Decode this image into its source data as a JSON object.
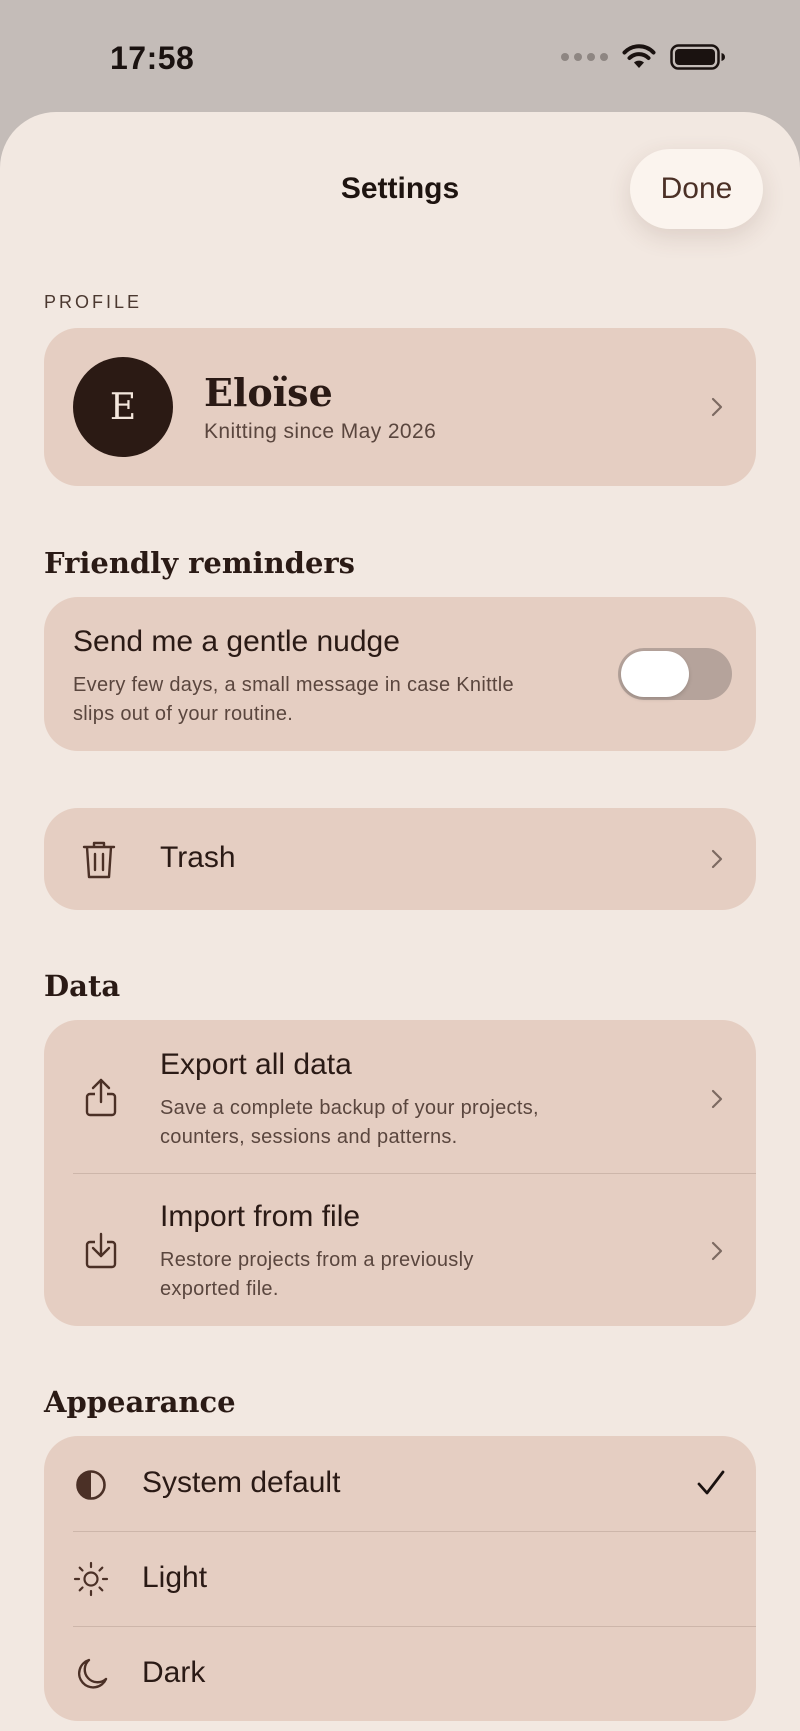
{
  "status_bar": {
    "time": "17:58"
  },
  "nav": {
    "title": "Settings",
    "done_label": "Done"
  },
  "profile": {
    "section_label": "PROFILE",
    "initial": "E",
    "name": "Eloïse",
    "subtitle": "Knitting since May 2026"
  },
  "reminders": {
    "section_label": "Friendly reminders",
    "title": "Send me a gentle nudge",
    "description_line1": "Every few days, a small message in case Knittle",
    "description_line2": "slips out of your routine.",
    "enabled": false
  },
  "trash": {
    "label": "Trash"
  },
  "data": {
    "section_label": "Data",
    "export": {
      "title": "Export all data",
      "line1": "Save a complete backup of your projects,",
      "line2": "counters, sessions and patterns."
    },
    "import": {
      "title": "Import from file",
      "line1": "Restore projects from a previously",
      "line2": "exported file."
    }
  },
  "appearance": {
    "section_label": "Appearance",
    "options": [
      {
        "label": "System default",
        "icon": "half-circle-icon",
        "selected": true
      },
      {
        "label": "Light",
        "icon": "sun-icon",
        "selected": false
      },
      {
        "label": "Dark",
        "icon": "moon-icon",
        "selected": false
      }
    ]
  },
  "colors": {
    "sheet_background": "#f2e8e1",
    "card_background": "#e5cec2",
    "text_primary": "#2a1a15",
    "avatar_background": "#2b1a14"
  }
}
